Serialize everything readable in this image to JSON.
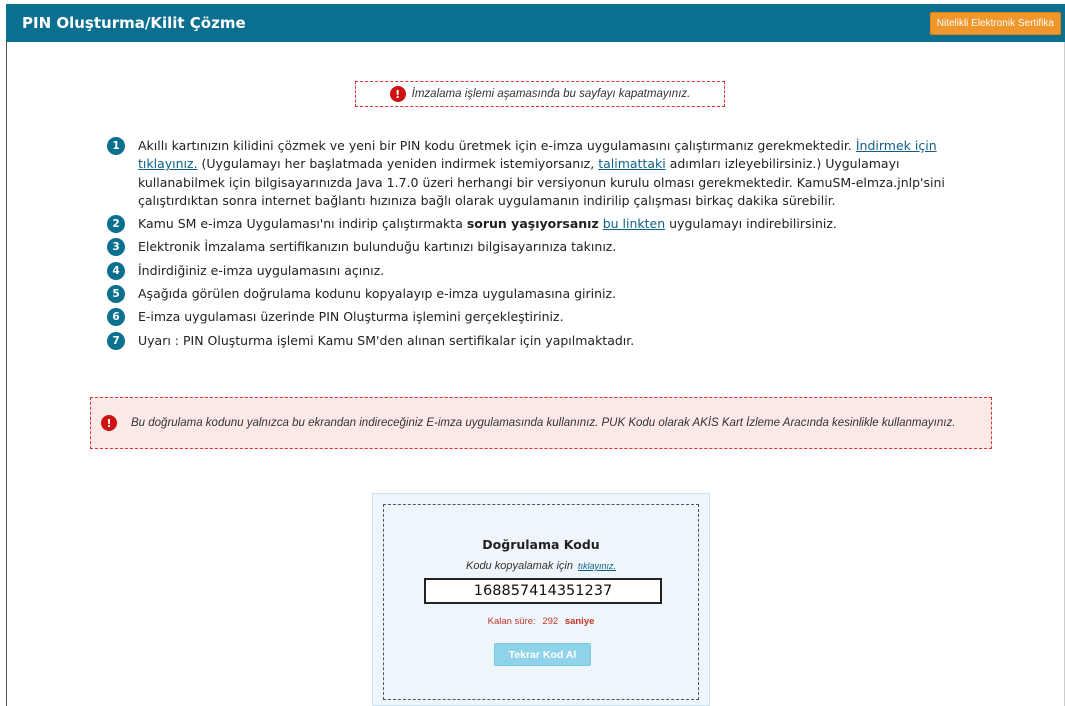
{
  "header": {
    "title": "PIN Oluşturma/Kilit Çözme",
    "cert_button": "Nitelikli Elektronik Sertifika"
  },
  "top_warning": "İmzalama işlemi aşamasında bu sayfayı kapatmayınız.",
  "steps": [
    {
      "num": "1",
      "t1": "Akıllı kartınızın kilidini çözmek ve yeni bir PIN kodu üretmek için e-imza uygulamasını çalıştırmanız gerekmektedir. ",
      "link1": "İndirmek için tıklayınız.",
      "t2": " (Uygulamayı her başlatmada yeniden indirmek istemiyorsanız, ",
      "link2": "talimattaki",
      "t3": " adımları izleyebilirsiniz.) Uygulamayı kullanabilmek için bilgisayarınızda Java 1.7.0 üzeri herhangi bir versiyonun kurulu olması gerekmektedir. KamuSM-elmza.jnlp'sini çalıştırdıktan sonra internet bağlantı hızınıza bağlı olarak uygulamanın indirilip çalışması birkaç dakika sürebilir."
    },
    {
      "num": "2",
      "t1": "Kamu SM e-imza Uygulaması'nı indirip çalıştırmakta ",
      "bold": "sorun yaşıyorsanız",
      "t2": " ",
      "link": "bu linkten",
      "t3": " uygulamayı indirebilirsiniz."
    },
    {
      "num": "3",
      "text": "Elektronik İmzalama sertifikanızın bulunduğu kartınızı bilgisayarınıza takınız."
    },
    {
      "num": "4",
      "text": "İndirdiğiniz e-imza uygulamasını açınız."
    },
    {
      "num": "5",
      "text": "Aşağıda görülen doğrulama kodunu kopyalayıp e-imza uygulamasına giriniz."
    },
    {
      "num": "6",
      "text": "E-imza uygulaması üzerinde PIN Oluşturma işlemini gerçekleştiriniz."
    },
    {
      "num": "7",
      "text": "Uyarı : PIN Oluşturma işlemi Kamu SM'den alınan sertifikalar için yapılmaktadır."
    }
  ],
  "main_warning": "Bu doğrulama kodunu yalnızca bu ekrandan indireceğiniz E-imza uygulamasında kullanınız. PUK Kodu olarak AKİS Kart İzleme Aracında kesinlikle kullanmayınız.",
  "verification": {
    "title": "Doğrulama Kodu",
    "copy_text": "Kodu kopyalamak için",
    "copy_link": "tıklayınız.",
    "code": "168857414351237",
    "timer_label": "Kalan süre:",
    "timer_value": "292",
    "timer_unit": "saniye",
    "retry_button": "Tekrar Kod Al"
  },
  "colors": {
    "header_bg": "#0b6f8f",
    "cert_button_bg": "#f0962a",
    "warning_border": "#dd3333",
    "warning_bg": "#fde8e8",
    "panel_bg": "#eef5fb",
    "retry_button_bg": "#8fd3ea"
  }
}
